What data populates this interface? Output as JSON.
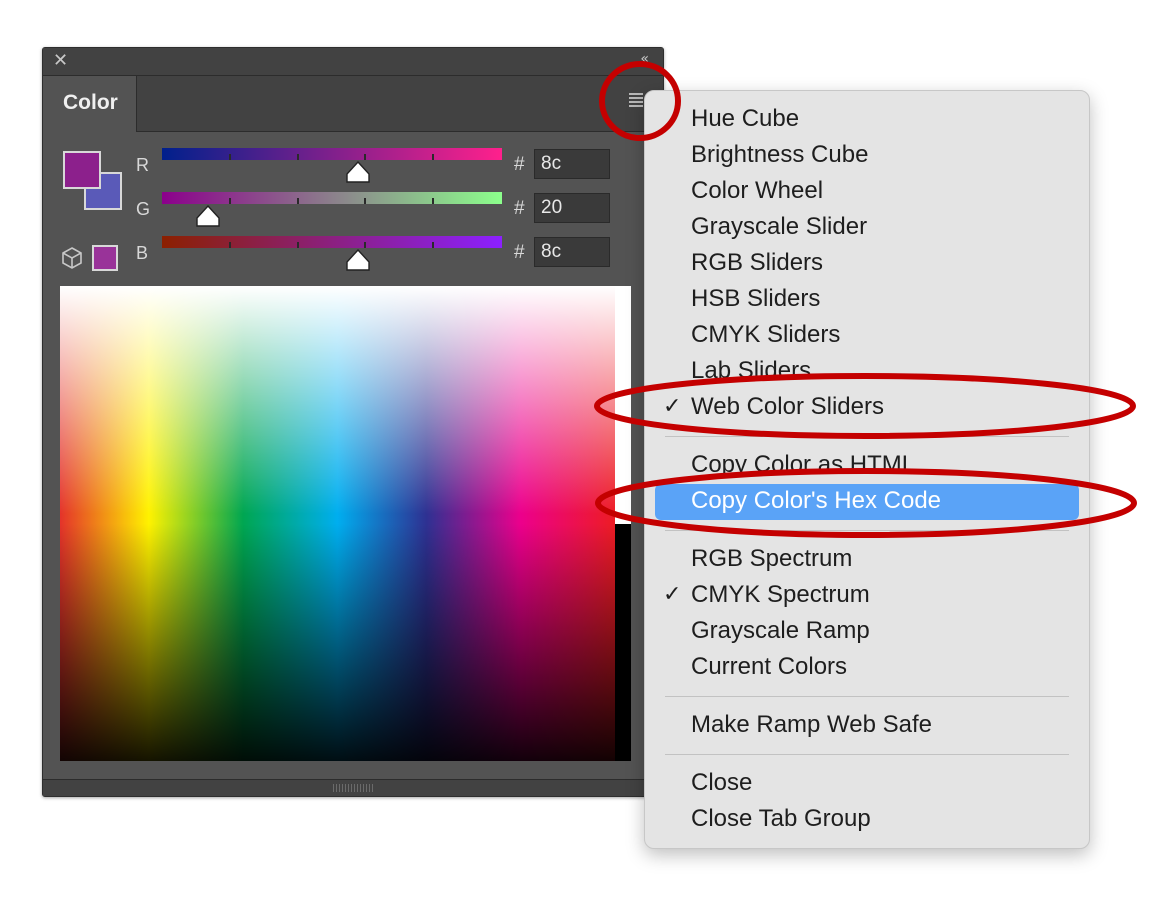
{
  "panel": {
    "close_glyph": "✕",
    "collapse_glyph": "«",
    "tab_label": "Color",
    "menu_icon": "hamburger-menu-icon",
    "foreground_color": "#8c208c",
    "background_color": "#5a5ab8",
    "websafe_color": "#993399",
    "channels": [
      {
        "label": "R",
        "hash": "#",
        "value": "8c",
        "level": 0.55
      },
      {
        "label": "G",
        "hash": "#",
        "value": "20",
        "level": 0.13
      },
      {
        "label": "B",
        "hash": "#",
        "value": "8c",
        "level": 0.55
      }
    ]
  },
  "menu": {
    "items": [
      {
        "label": "Hue Cube",
        "checked": false
      },
      {
        "label": "Brightness Cube",
        "checked": false
      },
      {
        "label": "Color Wheel",
        "checked": false
      },
      {
        "label": "Grayscale Slider",
        "checked": false
      },
      {
        "label": "RGB Sliders",
        "checked": false
      },
      {
        "label": "HSB Sliders",
        "checked": false
      },
      {
        "label": "CMYK Sliders",
        "checked": false
      },
      {
        "label": "Lab Sliders",
        "checked": false
      },
      {
        "label": "Web Color Sliders",
        "checked": true
      }
    ],
    "copy_items": [
      {
        "label": "Copy Color as HTML",
        "highlighted": false
      },
      {
        "label": "Copy Color's Hex Code",
        "highlighted": true
      }
    ],
    "spectrum_items": [
      {
        "label": "RGB Spectrum",
        "checked": false
      },
      {
        "label": "CMYK Spectrum",
        "checked": true
      },
      {
        "label": "Grayscale Ramp",
        "checked": false
      },
      {
        "label": "Current Colors",
        "checked": false
      }
    ],
    "websafe_item": "Make Ramp Web Safe",
    "close_items": [
      "Close",
      "Close Tab Group"
    ],
    "check_glyph": "✓",
    "highlight_color": "#5aa3f7"
  },
  "annotation_color": "#c40000"
}
